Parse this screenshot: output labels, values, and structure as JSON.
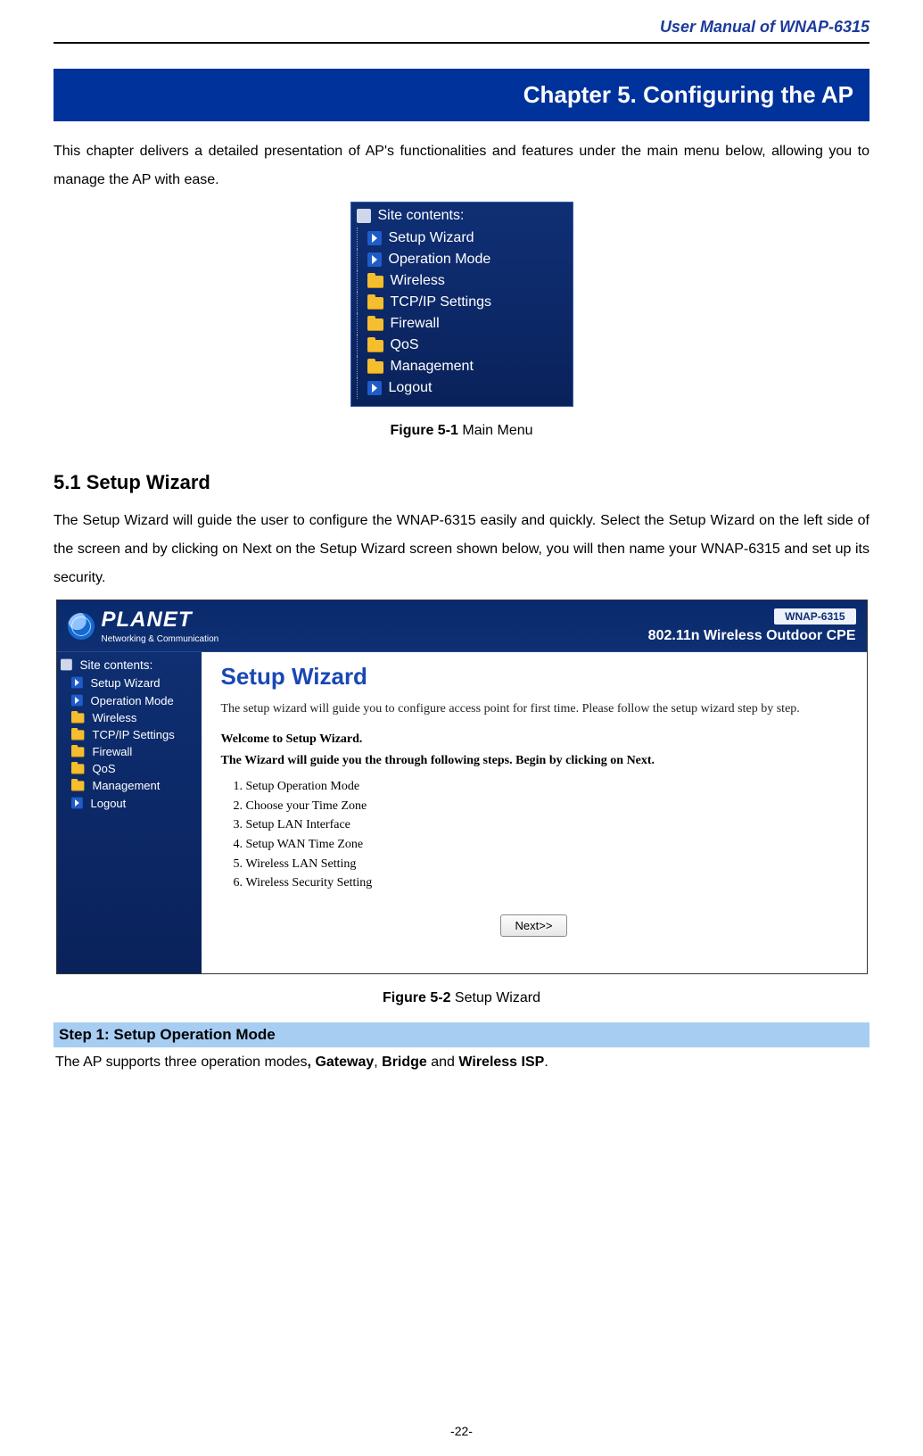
{
  "header": {
    "doc_title": "User Manual of WNAP-6315"
  },
  "chapter": {
    "title": "Chapter 5.    Configuring the AP",
    "intro": "This chapter delivers a detailed presentation of AP's functionalities and features under the main menu below, allowing you to manage the AP with ease."
  },
  "figure5_1": {
    "site_title": "Site contents:",
    "items": [
      {
        "label": "Setup Wizard",
        "icon": "arrow"
      },
      {
        "label": "Operation Mode",
        "icon": "arrow"
      },
      {
        "label": "Wireless",
        "icon": "folder"
      },
      {
        "label": "TCP/IP Settings",
        "icon": "folder"
      },
      {
        "label": "Firewall",
        "icon": "folder"
      },
      {
        "label": "QoS",
        "icon": "folder"
      },
      {
        "label": "Management",
        "icon": "folder"
      },
      {
        "label": "Logout",
        "icon": "arrow"
      }
    ],
    "caption_bold": "Figure 5-1",
    "caption_rest": " Main Menu"
  },
  "section5_1": {
    "heading": "5.1  Setup Wizard",
    "text": "The Setup Wizard will guide the user to configure the WNAP-6315 easily and quickly. Select the Setup Wizard on the left side of the screen and by clicking on Next on the Setup Wizard screen shown below, you will then name your WNAP-6315 and set up its security."
  },
  "figure5_2": {
    "brand": "PLANET",
    "brand_sub": "Networking & Communication",
    "model": "WNAP-6315",
    "product": "802.11n Wireless Outdoor CPE",
    "sidebar": {
      "title": "Site contents:",
      "items": [
        {
          "label": "Setup Wizard",
          "icon": "arrow"
        },
        {
          "label": "Operation Mode",
          "icon": "arrow"
        },
        {
          "label": "Wireless",
          "icon": "folder"
        },
        {
          "label": "TCP/IP Settings",
          "icon": "folder"
        },
        {
          "label": "Firewall",
          "icon": "folder"
        },
        {
          "label": "QoS",
          "icon": "folder"
        },
        {
          "label": "Management",
          "icon": "folder"
        },
        {
          "label": "Logout",
          "icon": "arrow"
        }
      ]
    },
    "main": {
      "heading": "Setup Wizard",
      "intro": "The setup wizard will guide you to configure access point for first time. Please follow the setup wizard step by step.",
      "welcome": "Welcome to Setup Wizard.",
      "lead": "The Wizard will guide you the through following steps. Begin by clicking on Next.",
      "steps": [
        "Setup Operation Mode",
        "Choose your Time Zone",
        "Setup LAN Interface",
        "Setup WAN Time Zone",
        "Wireless LAN Setting",
        "Wireless Security Setting"
      ],
      "next_label": "Next>>"
    },
    "caption_bold": "Figure 5-2",
    "caption_rest": " Setup Wizard"
  },
  "step1": {
    "bar": "Step 1: Setup Operation Mode",
    "text_pre": "The AP supports three operation modes",
    "mode1": ", Gateway",
    "comma": ", ",
    "mode2": "Bridge",
    "and": " and ",
    "mode3": "Wireless ISP",
    "period": "."
  },
  "footer": {
    "page": "-22-"
  }
}
